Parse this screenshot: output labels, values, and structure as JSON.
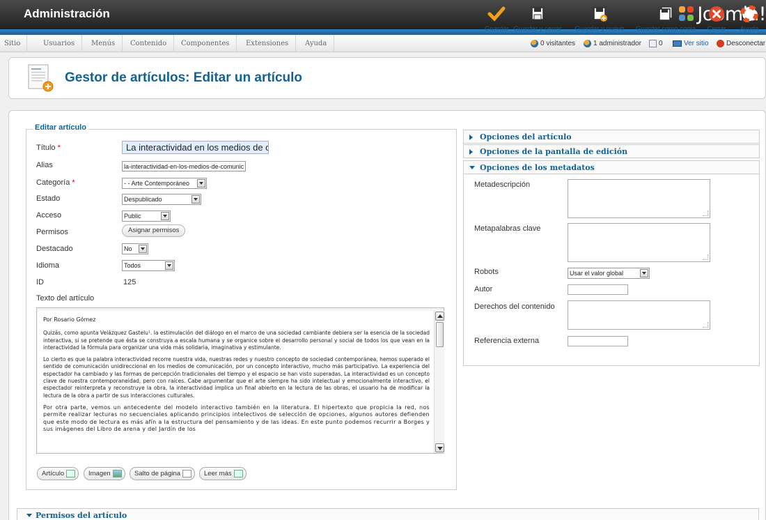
{
  "header": {
    "title": "Administración",
    "logo_text": "Joomla!"
  },
  "menu": [
    "Sitio",
    "Usuarios",
    "Menús",
    "Contenido",
    "Componentes",
    "Extensiones",
    "Ayuda"
  ],
  "status": {
    "visitors": "0 visitantes",
    "admins": "1 administrador",
    "messages": "0",
    "view_site": "Ver sitio",
    "logout": "Desconectar"
  },
  "toolbar": {
    "heading": "Gestor de artículos: Editar un artículo",
    "buttons": {
      "save": "Guardar",
      "save_close": "Guardar y cerrar",
      "save_new": "Guardar y nuevo",
      "save_copy": "Guardar como copia",
      "close": "Cerrar",
      "help": "Ayuda"
    }
  },
  "form": {
    "legend": "Editar artículo",
    "labels": {
      "title": "Título",
      "alias": "Alias",
      "category": "Categoría",
      "state": "Estado",
      "access": "Acceso",
      "permissions": "Permisos",
      "featured": "Destacado",
      "language": "Idioma",
      "id": "ID",
      "text": "Texto del artículo"
    },
    "required_mark": "*",
    "values": {
      "title": "La interactividad en los medios de c",
      "alias": "la-interactividad-en-los-medios-de-comunic",
      "category": "- - Arte Contemporáneo",
      "state": "Despublicado",
      "access": "Public",
      "permissions_button": "Asignar permisos",
      "featured": "No",
      "language": "Todos",
      "id": "125"
    }
  },
  "editor": {
    "author": "Por Rosario Gómez",
    "p1": "Quizás, como apunta Velázquez Gastelu¹. la estimulación del diálogo en el marco de una sociedad cambiante debiera ser la esencia de la sociedad interactiva, si se pretende que ésta se construya a escala humana y se organice sobre el desarrollo personal y social de todos los que vean en la interactividad la fórmula para organizar una vida más solidaria, imaginativa y estimulante.",
    "p2": "Lo cierto es que la palabra interactividad recorre nuestra vida, nuestras redes y nuestro concepto de sociedad contemporánea, hemos superado el sentido de comunicación unidireccional en los medios de comunicación, por un concepto interactivo, mucho más participativo. La experiencia del espectador ha cambiado y las formas de percepción tradicionales del tiempo y el espacio se han visto superadas. La interactividad es un concepto clave de nuestra contemporaneidad, pero con raíces. Cabe argumentar que el arte siempre ha sido intelectual y emocionalmente interactivo, el espectador reinterpreta y reconstruye la obra, la interactividad implica un final abierto en la lectura de las obras, el usuario ha de modificar la lectura de la obra a partir de sus interacciones culturales.",
    "p3": "Por otra parte, vemos un antecedente del modelo interactivo también en la literatura. El hipertexto que propicia la red, nos permite realizar lecturas no secuenciales aplicando principios intelectivos de selección de opciones, algunos autores defienden que este modo de lectura es más afín a la estructura del pensamiento y de las ideas. En este punto podemos recurrir a Borges y sus imágenes del Libro de arena y del Jardín de los",
    "buttons": {
      "article": "Artículo",
      "image": "Imagen",
      "pagebreak": "Salto de página",
      "readmore": "Leer más"
    }
  },
  "sidebar": {
    "article_options": "Opciones del artículo",
    "edit_screen_options": "Opciones de la pantalla de edición",
    "metadata_options": "Opciones de los metadatos",
    "labels": {
      "metadesc": "Metadescripción",
      "metakeys": "Metapalabras clave",
      "robots": "Robots",
      "author": "Autor",
      "rights": "Derechos del contenido",
      "xreference": "Referencia externa"
    },
    "robots_value": "Usar el valor global"
  },
  "permissions_section": "Permisos del artículo",
  "colors": {
    "accent_blue": "#146295",
    "header_dark": "#2b2b2b",
    "strip_blue": "#2f86c7",
    "required_red": "#cc0000"
  }
}
